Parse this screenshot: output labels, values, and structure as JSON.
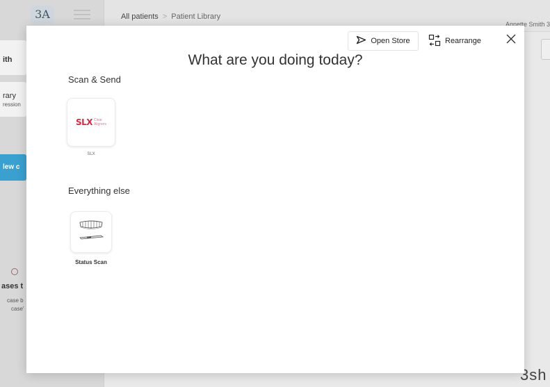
{
  "background": {
    "logo_text": "3Α",
    "breadcrumb": {
      "root": "All patients",
      "separator": ">",
      "current": "Patient Library"
    },
    "user_name": "Annette Smith 3",
    "brand_peek": "3sh",
    "peek": {
      "ith": "ith",
      "rary": "rary",
      "ression": "ression",
      "new": "lew c",
      "ases": "ases t",
      "case_b": "case b",
      "case2": "case'"
    }
  },
  "modal": {
    "title": "What are you doing today?",
    "open_store_label": "Open Store",
    "rearrange_label": "Rearrange",
    "sections": [
      {
        "title": "Scan & Send",
        "apps": [
          {
            "label": "SLX",
            "logo_mark": "SLX",
            "logo_sub_1": "Clear",
            "logo_sub_2": "Aligners"
          }
        ]
      },
      {
        "title": "Everything else",
        "apps": [
          {
            "label": "Status Scan"
          }
        ]
      }
    ]
  },
  "colors": {
    "accent_blue": "#3aa0cf",
    "slx_red": "#d42a45"
  }
}
